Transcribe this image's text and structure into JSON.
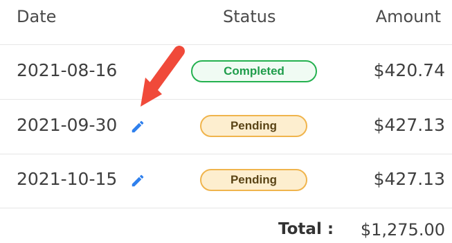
{
  "table": {
    "columns": {
      "date": "Date",
      "status": "Status",
      "amount": "Amount"
    },
    "rows": [
      {
        "date": "2021-08-16",
        "status": "Completed",
        "amount": "$420.74",
        "editable": false
      },
      {
        "date": "2021-09-30",
        "status": "Pending",
        "amount": "$427.13",
        "editable": true
      },
      {
        "date": "2021-10-15",
        "status": "Pending",
        "amount": "$427.13",
        "editable": true
      }
    ],
    "total_label": "Total :",
    "total_value": "$1,275.00"
  },
  "icons": {
    "edit": "pencil-icon",
    "annotation": "red-arrow"
  },
  "colors": {
    "completed": "#24b14f",
    "pending_border": "#f0b44c",
    "pending_fill": "#fdeecf",
    "edit_icon": "#2f80ed",
    "arrow": "#f04a3a"
  }
}
